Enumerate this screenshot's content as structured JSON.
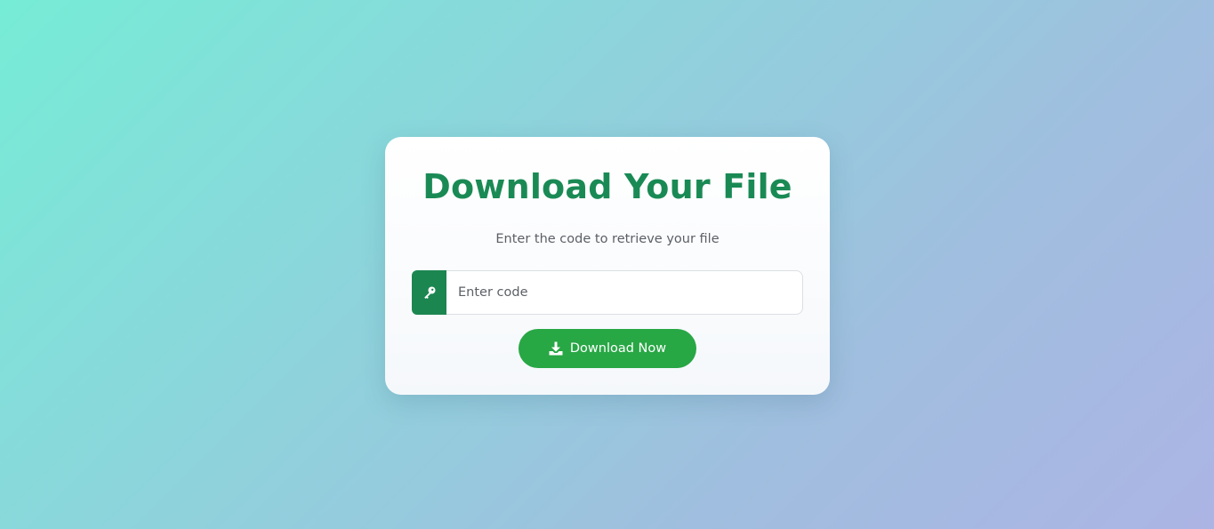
{
  "card": {
    "title": "Download Your File",
    "subtitle": "Enter the code to retrieve your file",
    "input": {
      "placeholder": "Enter code",
      "value": "",
      "icon": "key-icon"
    },
    "button": {
      "label": "Download Now",
      "icon": "download-icon"
    }
  },
  "colors": {
    "accent": "#1a8a55",
    "button": "#28a745",
    "background_start": "#76ecd6",
    "background_end": "#acb4e4"
  }
}
